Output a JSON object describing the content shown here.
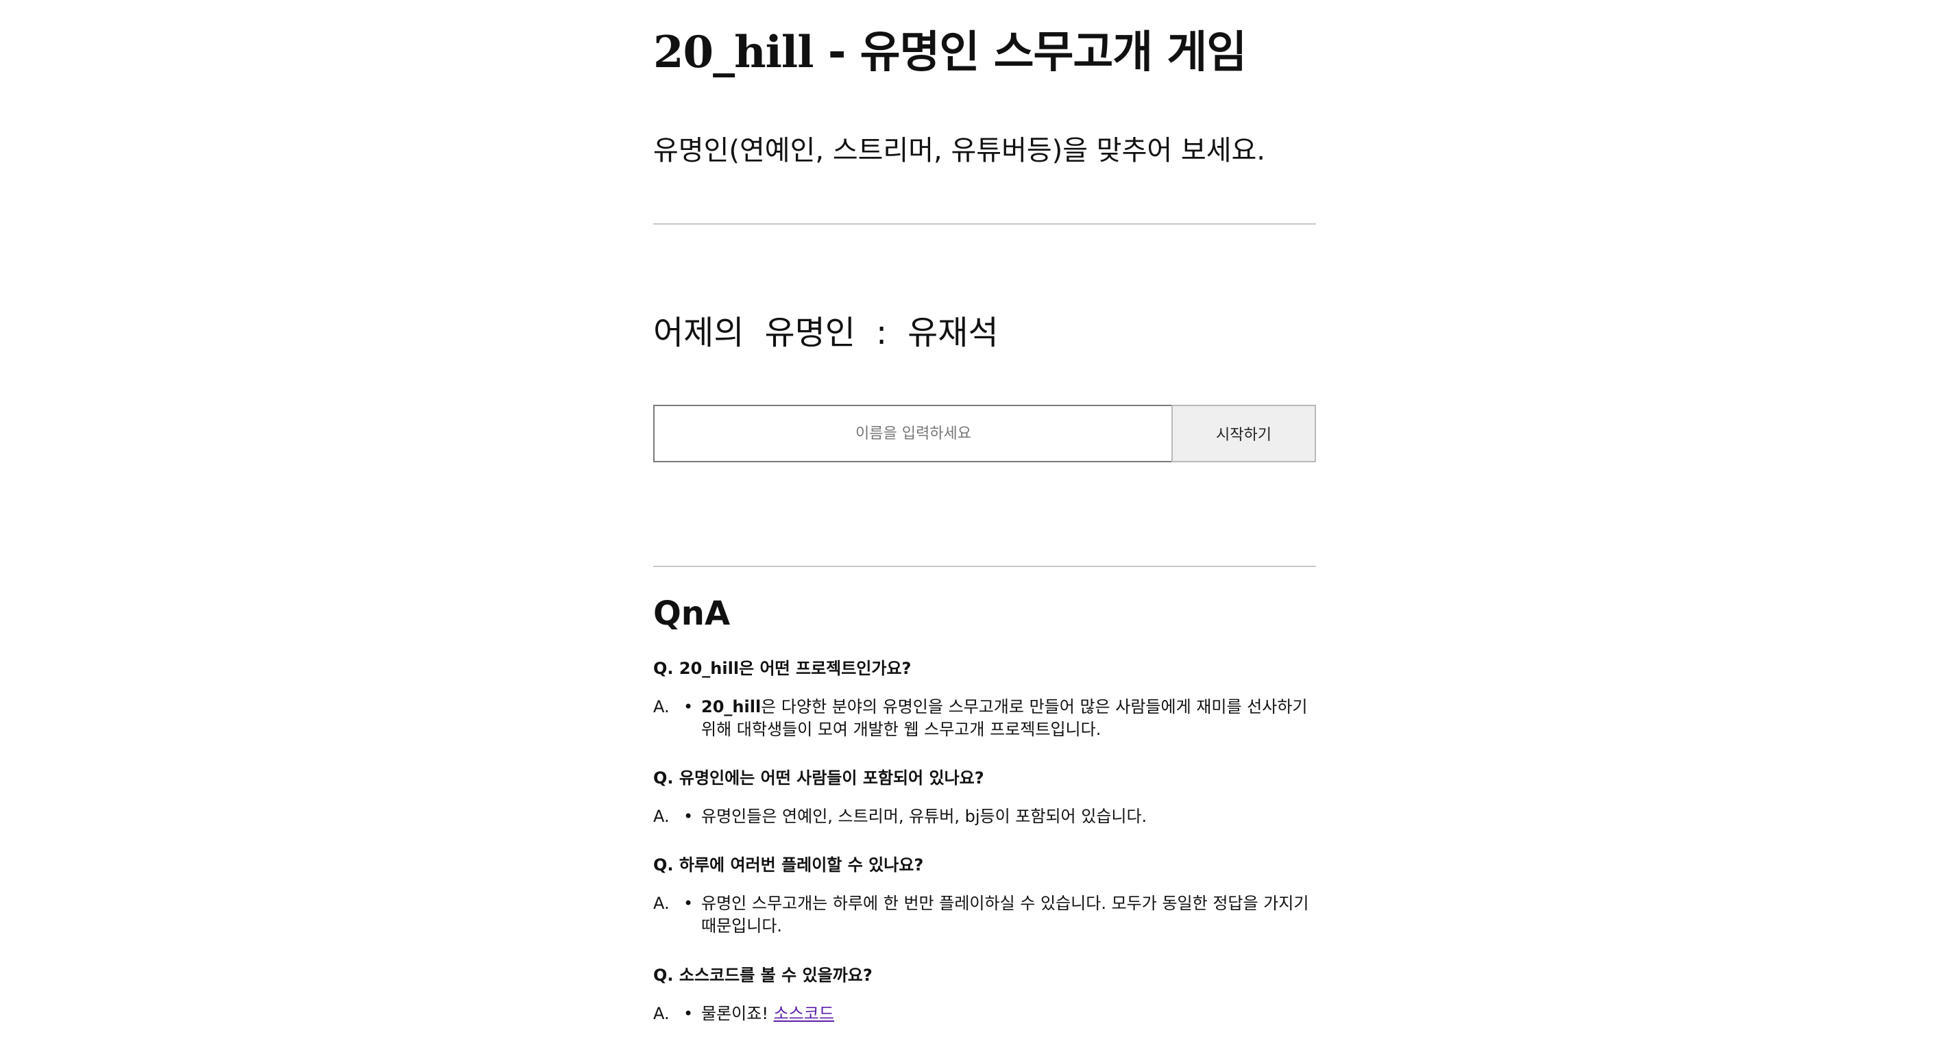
{
  "header": {
    "brand": "20_hill",
    "title_suffix": " - 유명인 스무고개 게임",
    "subtitle": "유명인(연예인, 스트리머, 유튜버등)을 맞추어 보세요."
  },
  "yesterday": {
    "label": "어제의",
    "word": "유명인",
    "separator": ":",
    "answer": "유재석"
  },
  "form": {
    "input_value": "",
    "input_placeholder": "이름을 입력하세요",
    "start_button_label": "시작하기"
  },
  "qna": {
    "title": "QnA",
    "answer_prefix": "A.",
    "bullet": "•",
    "items": [
      {
        "question": "Q. 20_hill은 어떤 프로젝트인가요?",
        "answer_bold": "20_hill",
        "answer": "은 다양한 분야의 유명인을 스무고개로 만들어 많은 사람들에게 재미를 선사하기 위해 대학생들이 모여 개발한 웹 스무고개 프로젝트입니다."
      },
      {
        "question": "Q. 유명인에는 어떤 사람들이 포함되어 있나요?",
        "answer": "유명인들은 연예인, 스트리머, 유튜버, bj등이 포함되어 있습니다."
      },
      {
        "question": "Q. 하루에 여러번 플레이할 수 있나요?",
        "answer": "유명인 스무고개는 하루에 한 번만 플레이하실 수 있습니다. 모두가 동일한 정답을 가지기 때문입니다."
      },
      {
        "question": "Q. 소스코드를 볼 수 있을까요?",
        "answer": "물론이죠!",
        "link_text": "소스코드"
      }
    ]
  },
  "colors": {
    "link": "#5a1fa8",
    "divider": "#c8c8c8",
    "button_bg": "#efefef"
  }
}
